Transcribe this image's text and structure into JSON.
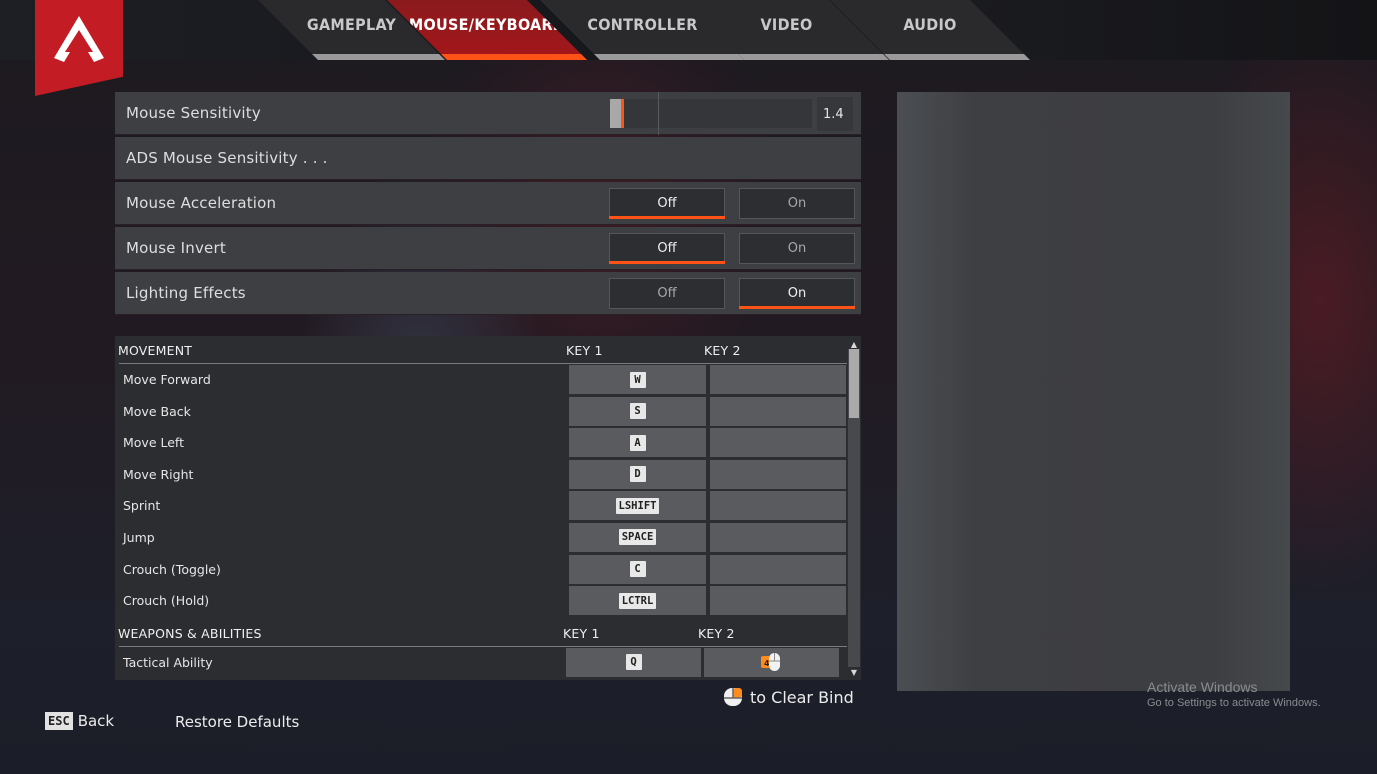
{
  "logo": {
    "icon": "apex-logo-icon"
  },
  "tabs": [
    {
      "label": "GAMEPLAY",
      "active": false
    },
    {
      "label": "MOUSE/KEYBOARD",
      "active": true
    },
    {
      "label": "CONTROLLER",
      "active": false
    },
    {
      "label": "VIDEO",
      "active": false
    },
    {
      "label": "AUDIO",
      "active": false
    }
  ],
  "settings": {
    "mouse_sensitivity": {
      "label": "Mouse Sensitivity",
      "value": "1.4",
      "slider_fraction": 0.055
    },
    "ads_mouse_sensitivity": {
      "label": "ADS Mouse Sensitivity . . ."
    },
    "mouse_acceleration": {
      "label": "Mouse Acceleration",
      "off": "Off",
      "on": "On",
      "selected": "off"
    },
    "mouse_invert": {
      "label": "Mouse Invert",
      "off": "Off",
      "on": "On",
      "selected": "off"
    },
    "lighting_effects": {
      "label": "Lighting Effects",
      "off": "Off",
      "on": "On",
      "selected": "on"
    }
  },
  "keybinds": {
    "movement": {
      "title": "MOVEMENT",
      "key1": "KEY 1",
      "key2": "KEY 2",
      "rows": [
        {
          "name": "Move Forward",
          "key1": "W",
          "key2": ""
        },
        {
          "name": "Move Back",
          "key1": "S",
          "key2": ""
        },
        {
          "name": "Move Left",
          "key1": "A",
          "key2": ""
        },
        {
          "name": "Move Right",
          "key1": "D",
          "key2": ""
        },
        {
          "name": "Sprint",
          "key1": "LSHIFT",
          "key2": ""
        },
        {
          "name": "Jump",
          "key1": "SPACE",
          "key2": ""
        },
        {
          "name": "Crouch (Toggle)",
          "key1": "C",
          "key2": ""
        },
        {
          "name": "Crouch (Hold)",
          "key1": "LCTRL",
          "key2": ""
        }
      ]
    },
    "weapons": {
      "title": "WEAPONS & ABILITIES",
      "key1": "KEY 1",
      "key2": "KEY 2",
      "rows": [
        {
          "name": "Tactical Ability",
          "key1": "Q",
          "key2": "mouse-button-4-icon",
          "key2_badge": "4"
        }
      ]
    }
  },
  "footer": {
    "clear_bind": "to Clear Bind",
    "esc_key": "ESC",
    "back": "Back",
    "restore_defaults": "Restore Defaults"
  },
  "watermark": {
    "title": "Activate Windows",
    "subtitle": "Go to Settings to activate Windows."
  },
  "colors": {
    "accent": "#ff5216",
    "brand_red": "#c41c24"
  }
}
